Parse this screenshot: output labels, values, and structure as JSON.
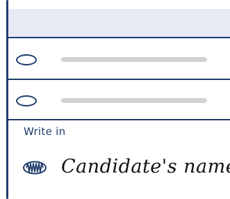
{
  "ballot": {
    "write_in_label": "Write in",
    "write_in_value": "Candidate's name",
    "options": [
      {
        "selected": false
      },
      {
        "selected": false
      }
    ],
    "colors": {
      "accent": "#1f3d6b",
      "header_fill": "#e6eaf5",
      "placeholder": "#d3d3d3",
      "ink": "#111111"
    },
    "icons": {
      "filled_bubble": "filled-bubble-icon"
    }
  }
}
